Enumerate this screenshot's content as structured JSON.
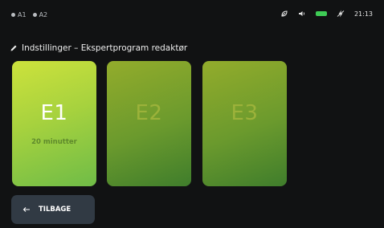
{
  "status_bar": {
    "indicators": [
      {
        "icon": "dot-icon",
        "label": "A1"
      },
      {
        "icon": "dot-icon",
        "label": "A2"
      }
    ],
    "icons": [
      "eco-icon",
      "volume-icon",
      "battery-icon",
      "charging-icon"
    ],
    "battery_color": "#3ecb55",
    "time": "21:13"
  },
  "header": {
    "icon": "pencil-icon",
    "title": "Indstillinger – Ekspertprogram redaktør"
  },
  "programs": [
    {
      "code": "E1",
      "duration": "20 minutter",
      "selected": true,
      "color": "#a7d23e"
    },
    {
      "code": "E2",
      "duration": "",
      "selected": false,
      "color": "#6b9a2d"
    },
    {
      "code": "E3",
      "duration": "",
      "selected": false,
      "color": "#6b9a2d"
    }
  ],
  "back_button": {
    "icon": "arrow-left-icon",
    "label": "TILBAGE"
  }
}
